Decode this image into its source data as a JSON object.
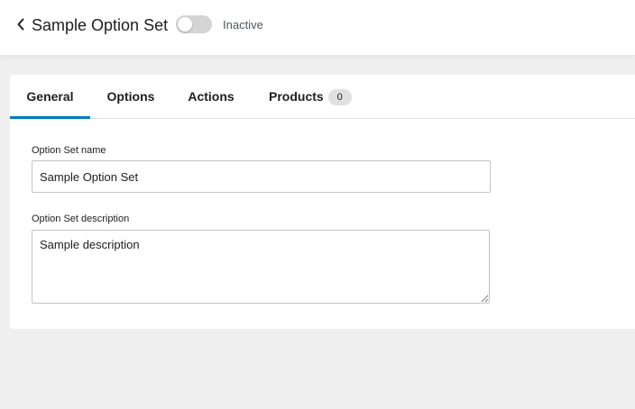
{
  "header": {
    "title": "Sample Option Set",
    "status_label": "Inactive",
    "toggle_on": false,
    "back_icon": "chevron-left-icon"
  },
  "tabs": [
    {
      "label": "General",
      "active": true
    },
    {
      "label": "Options",
      "active": false
    },
    {
      "label": "Actions",
      "active": false
    },
    {
      "label": "Products",
      "active": false,
      "count": "0"
    }
  ],
  "form": {
    "name_label": "Option Set name",
    "name_value": "Sample Option Set",
    "description_label": "Option Set description",
    "description_value": "Sample description"
  },
  "colors": {
    "accent": "#007cba",
    "toggle_off": "#d4d4d4",
    "background": "#efefef"
  }
}
